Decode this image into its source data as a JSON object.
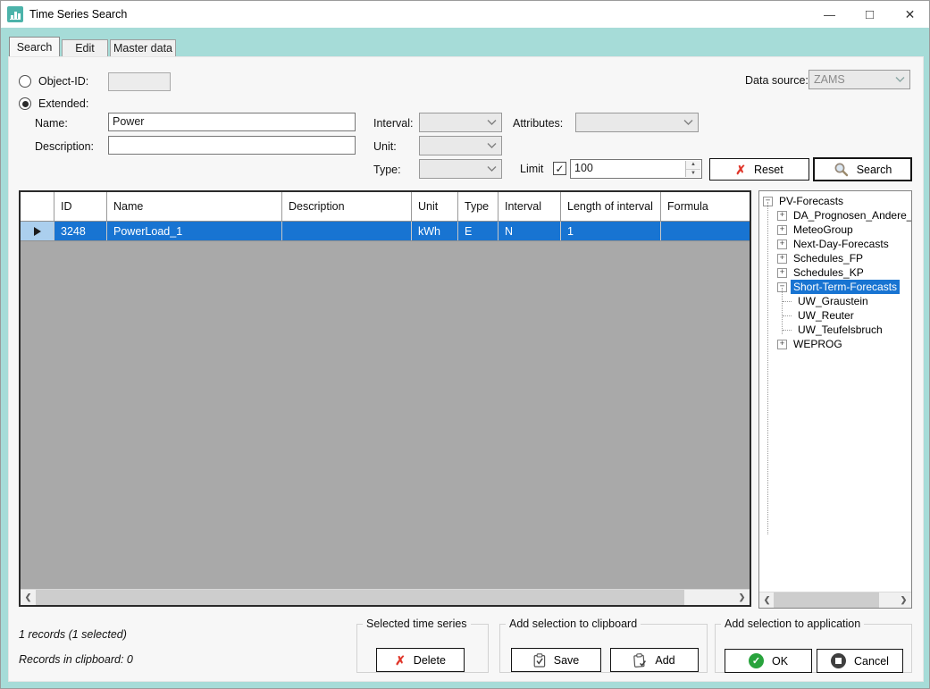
{
  "window": {
    "title": "Time Series Search",
    "controls": {
      "minimize": "—",
      "maximize": "□",
      "close": "✕"
    }
  },
  "tabs": [
    {
      "label": "Search",
      "active": true
    },
    {
      "label": "Edit",
      "active": false
    },
    {
      "label": "Master data",
      "active": false
    }
  ],
  "form": {
    "object_id_label": "Object-ID:",
    "object_id_value": "",
    "extended_label": "Extended:",
    "name_label": "Name:",
    "name_value": "Power",
    "description_label": "Description:",
    "description_value": "",
    "interval_label": "Interval:",
    "interval_value": "",
    "unit_label": "Unit:",
    "unit_value": "",
    "type_label": "Type:",
    "type_value": "",
    "attributes_label": "Attributes:",
    "attributes_value": "",
    "limit_label": "Limit",
    "limit_checked_glyph": "✓",
    "limit_value": "100",
    "data_source_label": "Data source:",
    "data_source_value": "ZAMS",
    "reset_label": "Reset",
    "search_label": "Search"
  },
  "table": {
    "headers": [
      "",
      "ID",
      "Name",
      "Description",
      "Unit",
      "Type",
      "Interval",
      "Length of interval",
      "Formula"
    ],
    "rows": [
      {
        "id": "3248",
        "name": "PowerLoad_1",
        "description": "",
        "unit": "kWh",
        "type": "E",
        "interval": "N",
        "length_of_interval": "1",
        "formula": "",
        "selected": true
      }
    ]
  },
  "tree": {
    "items": [
      {
        "label": "PV-Forecasts",
        "level": 0,
        "glyph": "−"
      },
      {
        "label": "DA_Prognosen_Andere_",
        "level": 1,
        "glyph": "+"
      },
      {
        "label": "MeteoGroup",
        "level": 1,
        "glyph": "+"
      },
      {
        "label": "Next-Day-Forecasts",
        "level": 1,
        "glyph": "+"
      },
      {
        "label": "Schedules_FP",
        "level": 1,
        "glyph": "+"
      },
      {
        "label": "Schedules_KP",
        "level": 1,
        "glyph": "+"
      },
      {
        "label": "Short-Term-Forecasts",
        "level": 1,
        "glyph": "−",
        "selected": true
      },
      {
        "label": "UW_Graustein",
        "level": 2,
        "glyph": ""
      },
      {
        "label": "UW_Reuter",
        "level": 2,
        "glyph": ""
      },
      {
        "label": "UW_Teufelsbruch",
        "level": 2,
        "glyph": ""
      },
      {
        "label": "WEPROG",
        "level": 1,
        "glyph": "+"
      }
    ]
  },
  "status": {
    "records": "1 records (1 selected)",
    "clipboard": "Records in clipboard: 0"
  },
  "groups": {
    "selected_time_series": {
      "label": "Selected time series",
      "delete_label": "Delete"
    },
    "clipboard": {
      "label": "Add selection to clipboard",
      "save_label": "Save",
      "add_label": "Add"
    },
    "application": {
      "label": "Add selection to application",
      "ok_label": "OK",
      "cancel_label": "Cancel"
    }
  },
  "icons": {
    "reset_x": "✗",
    "delete_x": "✗",
    "ok_check": "✓",
    "scroll_left": "❮",
    "scroll_right": "❯"
  },
  "colors": {
    "accent_teal": "#a6dcd8",
    "selection_blue": "#1874d2",
    "row_selector_blue": "#abcfee",
    "grid_empty_gray": "#a9a9a9",
    "icon_teal": "#4cb3aa",
    "danger_red": "#e0372b",
    "ok_green": "#28a33c"
  }
}
